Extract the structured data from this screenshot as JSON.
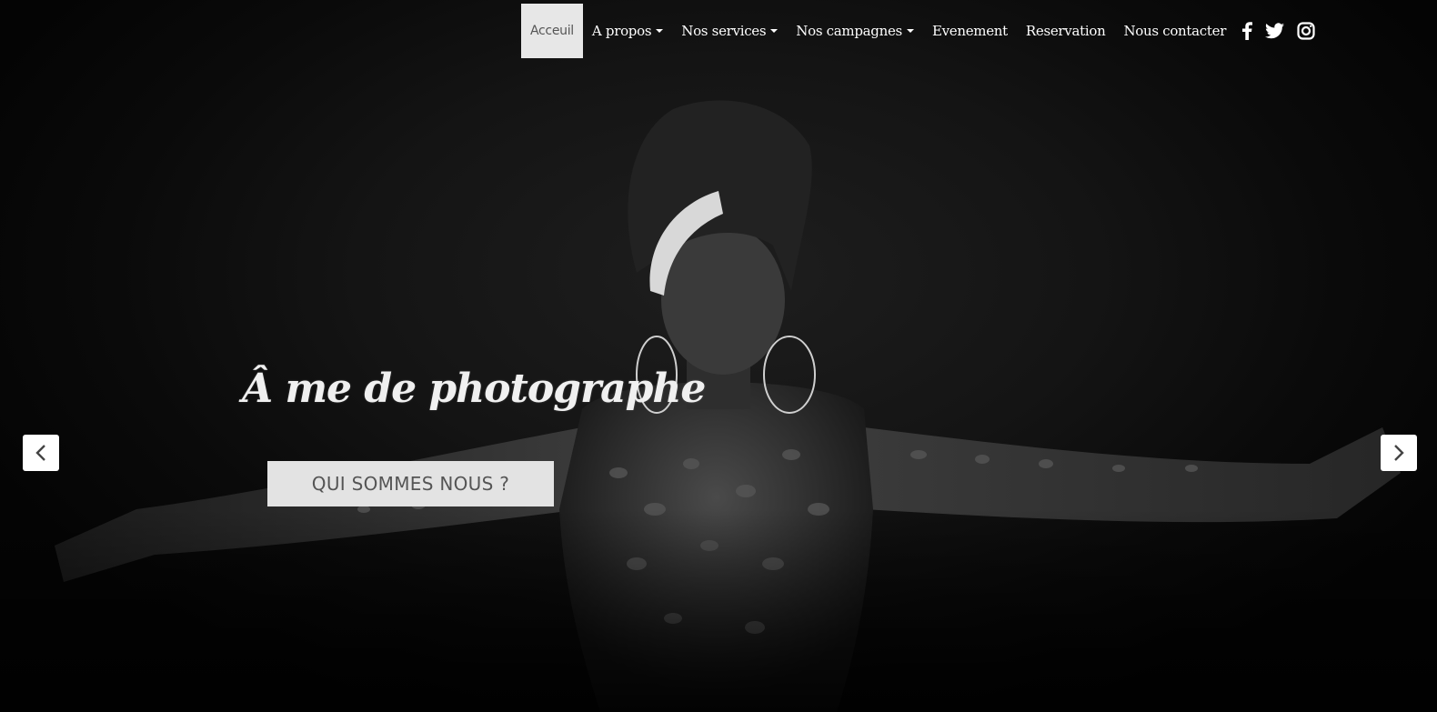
{
  "nav": {
    "items": [
      {
        "label": "Acceuil",
        "active": true,
        "dropdown": false
      },
      {
        "label": "A propos",
        "active": false,
        "dropdown": true
      },
      {
        "label": "Nos services",
        "active": false,
        "dropdown": true
      },
      {
        "label": "Nos campagnes",
        "active": false,
        "dropdown": true
      },
      {
        "label": "Evenement",
        "active": false,
        "dropdown": false
      },
      {
        "label": "Reservation",
        "active": false,
        "dropdown": false
      },
      {
        "label": "Nous contacter",
        "active": false,
        "dropdown": false
      }
    ],
    "social": [
      "facebook-icon",
      "twitter-icon",
      "instagram-icon"
    ]
  },
  "hero": {
    "title": "Â me de photographe",
    "cta_label": "QUI SOMMES NOUS ?"
  },
  "carousel": {
    "prev_icon": "chevron-left-icon",
    "next_icon": "chevron-right-icon"
  },
  "colors": {
    "background": "#000000",
    "active_nav_bg": "#e7e7e7",
    "cta_bg": "#e3e3e3",
    "cta_text": "#555555"
  }
}
